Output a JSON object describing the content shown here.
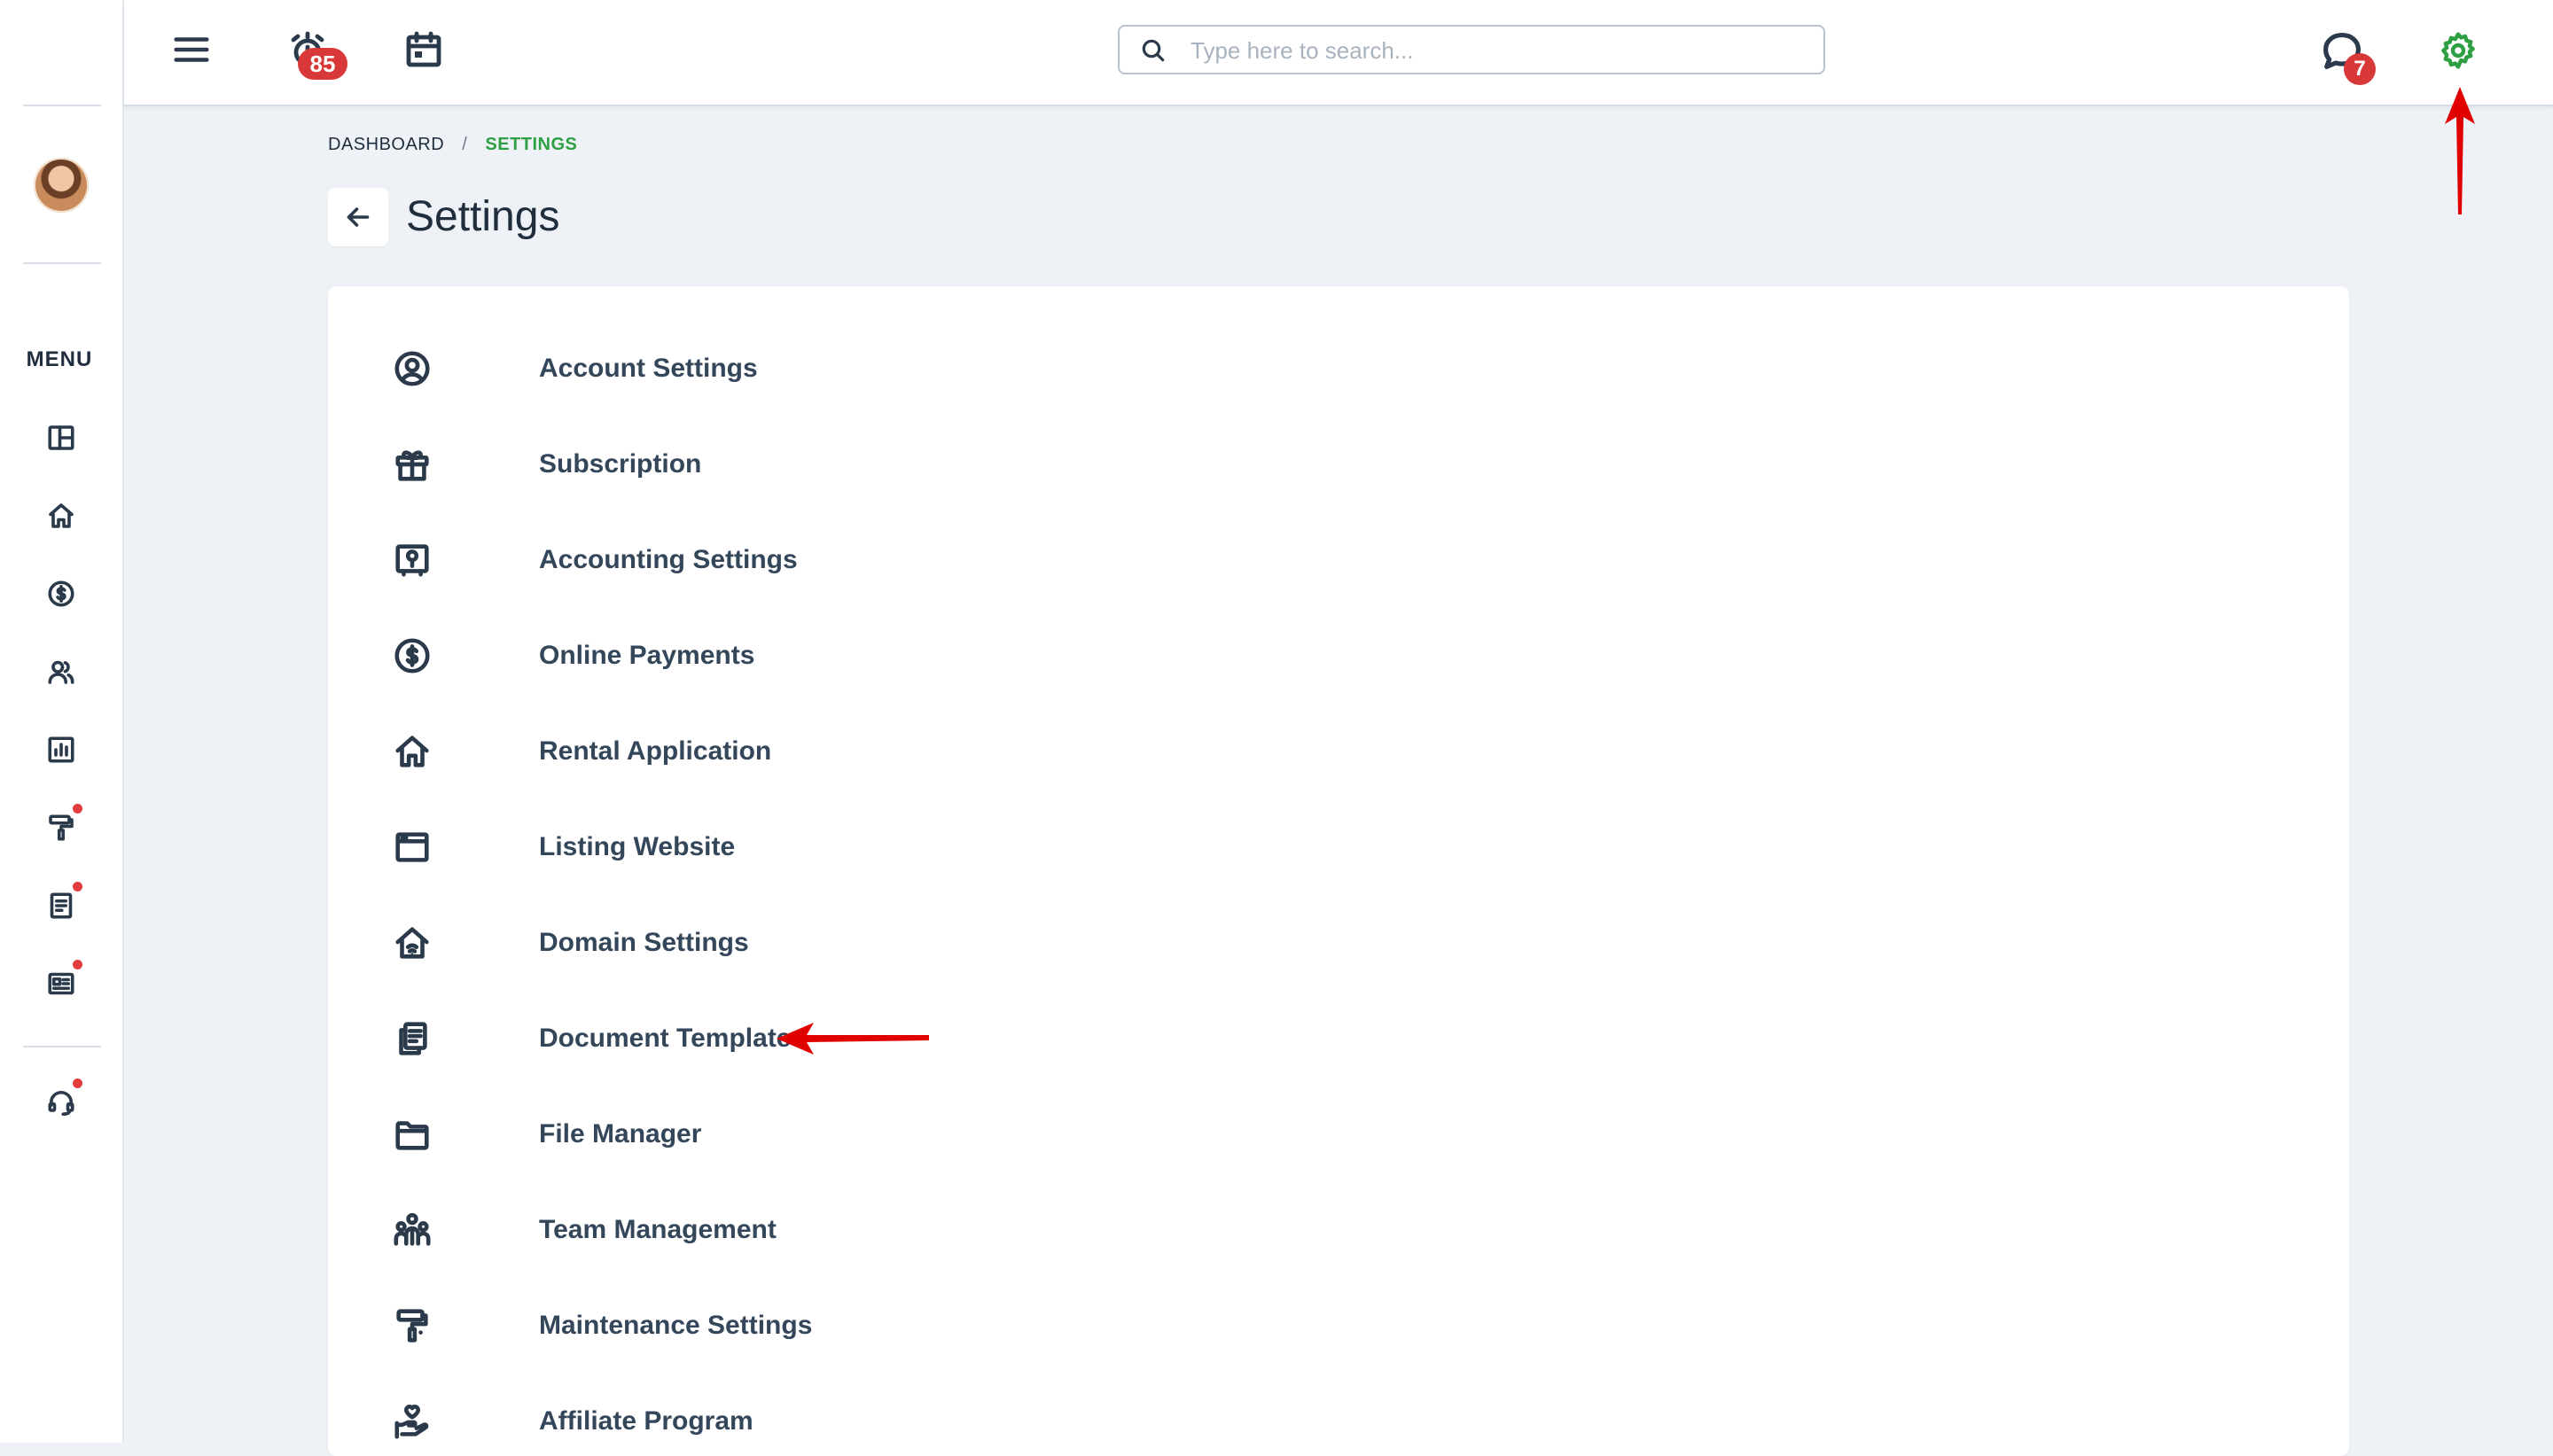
{
  "topbar": {
    "alerts_count": "85",
    "messages_count": "7",
    "search_placeholder": "Type here to search..."
  },
  "sidebar": {
    "menu_label": "MENU",
    "items": [
      {
        "icon": "dashboard-icon",
        "dot": false
      },
      {
        "icon": "home-icon",
        "dot": false
      },
      {
        "icon": "dollar-circle-icon",
        "dot": false
      },
      {
        "icon": "people-icon",
        "dot": false
      },
      {
        "icon": "report-chart-icon",
        "dot": false
      },
      {
        "icon": "paint-roller-icon",
        "dot": true
      },
      {
        "icon": "document-icon",
        "dot": true
      },
      {
        "icon": "listing-icon",
        "dot": true
      }
    ],
    "support_icon": "headset-icon"
  },
  "breadcrumb": {
    "root": "DASHBOARD",
    "separator": "/",
    "current": "SETTINGS"
  },
  "page": {
    "title": "Settings"
  },
  "settings_items": [
    {
      "label": "Account Settings",
      "icon": "user-circle-icon"
    },
    {
      "label": "Subscription",
      "icon": "gift-icon"
    },
    {
      "label": "Accounting Settings",
      "icon": "safe-icon"
    },
    {
      "label": "Online Payments",
      "icon": "dollar-circle-icon"
    },
    {
      "label": "Rental Application",
      "icon": "home-icon"
    },
    {
      "label": "Listing Website",
      "icon": "browser-window-icon"
    },
    {
      "label": "Domain Settings",
      "icon": "home-wifi-icon"
    },
    {
      "label": "Document Templates",
      "icon": "copy-document-icon"
    },
    {
      "label": "File Manager",
      "icon": "folder-icon"
    },
    {
      "label": "Team Management",
      "icon": "team-icon"
    },
    {
      "label": "Maintenance Settings",
      "icon": "paint-roller-icon"
    },
    {
      "label": "Affiliate Program",
      "icon": "hand-heart-icon"
    }
  ],
  "colors": {
    "accent_green": "#2ea043",
    "badge_red": "#d93838",
    "annotation_red": "#e00000"
  }
}
